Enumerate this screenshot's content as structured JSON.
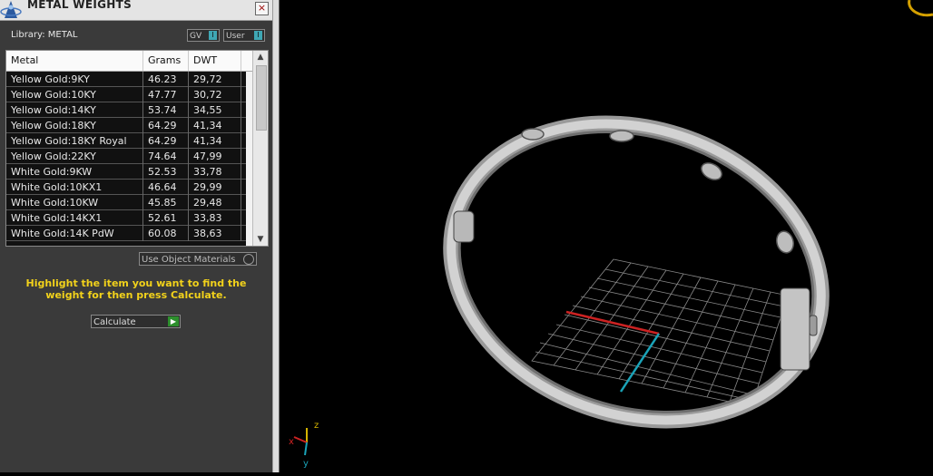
{
  "panel": {
    "title": "METAL WEIGHTS",
    "close": "×",
    "library_label": "Library: METAL",
    "toggles": [
      {
        "label": "GV",
        "knob": "I"
      },
      {
        "label": "User",
        "knob": "I"
      }
    ],
    "columns": [
      "Metal",
      "Grams",
      "DWT"
    ],
    "rows": [
      {
        "metal": "Yellow Gold:9KY",
        "grams": "46.23",
        "dwt": "29,72"
      },
      {
        "metal": "Yellow Gold:10KY",
        "grams": "47.77",
        "dwt": "30,72"
      },
      {
        "metal": "Yellow Gold:14KY",
        "grams": "53.74",
        "dwt": "34,55"
      },
      {
        "metal": "Yellow Gold:18KY",
        "grams": "64.29",
        "dwt": "41,34"
      },
      {
        "metal": "Yellow Gold:18KY Royal",
        "grams": "64.29",
        "dwt": "41,34"
      },
      {
        "metal": "Yellow Gold:22KY",
        "grams": "74.64",
        "dwt": "47,99"
      },
      {
        "metal": "White Gold:9KW",
        "grams": "52.53",
        "dwt": "33,78"
      },
      {
        "metal": "White Gold:10KX1",
        "grams": "46.64",
        "dwt": "29,99"
      },
      {
        "metal": "White Gold:10KW",
        "grams": "45.85",
        "dwt": "29,48"
      },
      {
        "metal": "White Gold:14KX1",
        "grams": "52.61",
        "dwt": "33,83"
      },
      {
        "metal": "White Gold:14K PdW",
        "grams": "60.08",
        "dwt": "38,63"
      }
    ],
    "use_object_materials": "Use Object Materials",
    "hint": "Highlight the item you want to find the weight for then press Calculate.",
    "calculate": "Calculate",
    "calculate_icon": "play-arrow-icon"
  },
  "viewport": {
    "axis_labels": {
      "z": "z",
      "x": "x",
      "y": "y"
    },
    "colors": {
      "x_axis": "#cc2222",
      "y_axis": "#1aa3b8",
      "z_axis": "#d4b400",
      "grid": "#8a8a8a",
      "ring": "#c8c8c8"
    }
  }
}
